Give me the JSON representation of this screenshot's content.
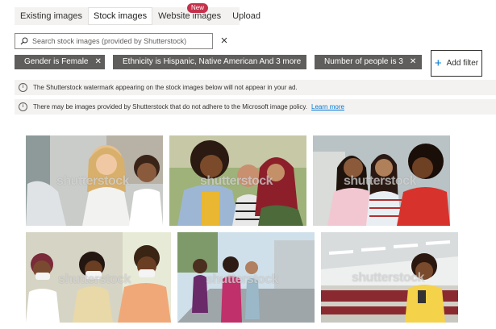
{
  "tabs": [
    {
      "label": "Existing images",
      "active": false
    },
    {
      "label": "Stock images",
      "active": true
    },
    {
      "label": "Website images",
      "active": false
    },
    {
      "label": "Upload",
      "active": false
    }
  ],
  "new_badge": "New",
  "search": {
    "placeholder": "Search stock images (provided by Shutterstock)"
  },
  "filters": [
    {
      "label": "Gender is Female"
    },
    {
      "label": "Ethnicity is Hispanic, Native American And 3 more"
    },
    {
      "label": "Number of people is 3"
    }
  ],
  "add_filter_label": "Add filter",
  "info_bars": [
    {
      "text": "The Shutterstock watermark appearing on the stock images below will not appear in your ad."
    },
    {
      "text": "There may be images provided by Shutterstock that do not adhere to the Microsoft image policy.",
      "link": "Learn more"
    }
  ],
  "watermark": "shutterstock",
  "images": [
    {
      "name": "three women smiling indoors"
    },
    {
      "name": "three women outdoors"
    },
    {
      "name": "three women laughing"
    },
    {
      "name": "three women with face masks"
    },
    {
      "name": "three women jogging"
    },
    {
      "name": "woman in lecture hall"
    }
  ],
  "colors": {
    "accent": "#0078d4",
    "chip_bg": "#605e5c",
    "badge": "#c4314b",
    "info_bg": "#f3f2f1"
  }
}
